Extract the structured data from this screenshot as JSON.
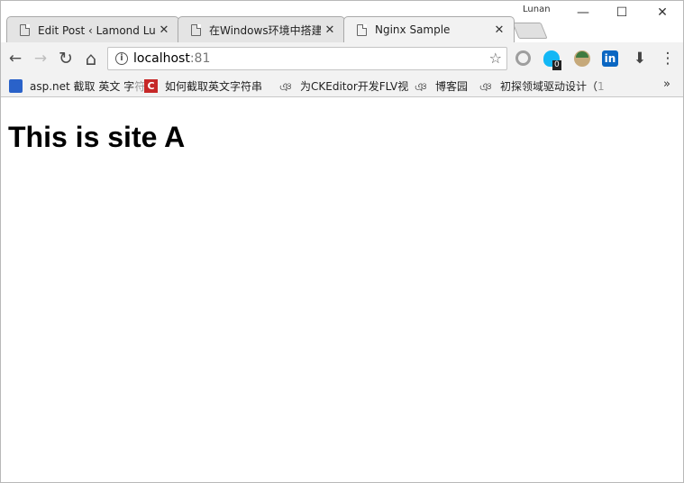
{
  "window": {
    "profile": "Lunan",
    "minimize_label": "—",
    "maximize_label": "☐",
    "close_label": "✕"
  },
  "tabs": [
    {
      "title": "Edit Post ‹ Lamond Lu的",
      "close": "✕"
    },
    {
      "title": "在Windows环境中搭建",
      "close": "✕"
    },
    {
      "title": "Nginx Sample",
      "close": "✕"
    }
  ],
  "toolbar": {
    "back": "←",
    "forward": "→",
    "reload": "↻",
    "home": "⌂",
    "star": "☆",
    "ext_badge": "0",
    "download": "⬇",
    "menu": "⋮"
  },
  "omnibox": {
    "info": "i",
    "host": "localhost",
    "port": ":81"
  },
  "bookmarks": [
    {
      "label": "asp.net 截取 英文 字",
      "fade": "符",
      "icon": "paw-icon"
    },
    {
      "label": "如何截取英文字符串",
      "fade": "",
      "icon": "c-icon"
    },
    {
      "label": "为CKEditor开发FLV视",
      "fade": "",
      "icon": "cnblogs-icon"
    },
    {
      "label": "博客园",
      "fade": "",
      "icon": "cnblogs-icon"
    },
    {
      "label": "初探领域驱动设计（",
      "fade": "1",
      "icon": "cnblogs-icon"
    }
  ],
  "bookmarks_overflow": "»",
  "page": {
    "heading": "This is site A"
  },
  "colors": {
    "chrome_bg": "#f2f2f2",
    "tab_inactive": "#e4e4e4",
    "cnblogs_red": "#c62828",
    "linkedin_blue": "#0a66c2",
    "qq_blue": "#12b7f5"
  }
}
